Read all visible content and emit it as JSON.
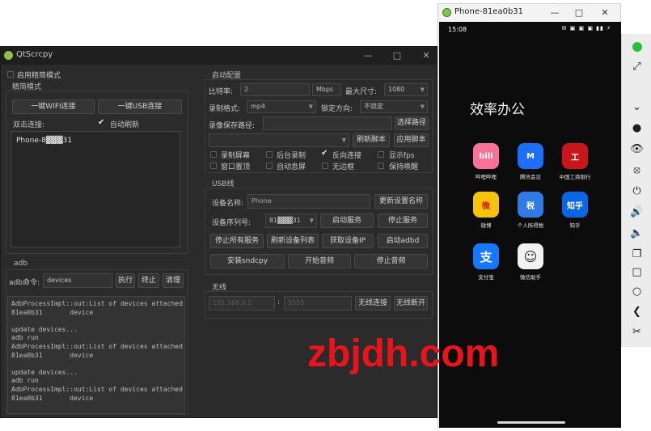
{
  "qt": {
    "title": "QtScrcpy",
    "simple_mode_check": "启用精简模式",
    "simple_mode_title": "精简模式",
    "wifi_btn": "一键WIFI连接",
    "usb_btn": "一键USB连接",
    "double_click_label": "双击连接:",
    "auto_refresh": "自动刷新",
    "device_item": "Phone-8▓▓▓31",
    "adb_title": "adb",
    "adb_cmd_label": "adb命令:",
    "adb_cmd_value": "devices",
    "run_btn": "执行",
    "stop_btn": "终止",
    "clear_btn": "清理",
    "log_text": "AdbProcessImpl::out:List of devices attached\n81ea0b31       device\n\nupdate devices...\nadb run\nAdbProcessImpl::out:List of devices attached\n81ea0b31       device\n\nupdate devices...\nadb run\nAdbProcessImpl::out:List of devices attached\n81ea0b31       device",
    "start_config_title": "启动配置",
    "bitrate_label": "比特率:",
    "bitrate_value": "2",
    "bitrate_unit": "Mbps",
    "max_size_label": "最大尺寸:",
    "max_size_value": "1080",
    "record_format_label": "录制格式:",
    "record_format_value": "mp4",
    "lock_dir_label": "锁定方向:",
    "lock_dir_value": "不锁定",
    "record_path_label": "录像保存路径:",
    "select_path_btn": "选择路径",
    "refresh_script_btn": "刷新脚本",
    "apply_script_btn": "应用脚本",
    "opt_record_screen": "录制屏幕",
    "opt_bg_record": "后台录制",
    "opt_reverse_conn": "反向连接",
    "opt_show_fps": "显示fps",
    "opt_window_top": "窗口置顶",
    "opt_auto_off": "自动息屏",
    "opt_frameless": "无边框",
    "opt_keep_awake": "保持唤醒",
    "usb_title": "USB线",
    "device_name_label": "设备名称:",
    "device_name_value": "Phone",
    "update_name_btn": "更新设置名称",
    "serial_label": "设备序列号:",
    "serial_value": "81▓▓▓31",
    "start_service_btn": "启动服务",
    "stop_service_btn": "停止服务",
    "stop_all_btn": "停止所有服务",
    "refresh_list_btn": "刷新设备列表",
    "get_ip_btn": "获取设备IP",
    "start_adbd_btn": "启动adbd",
    "install_sndcpy_btn": "安装sndcpy",
    "start_audio_btn": "开始音频",
    "stop_audio_btn": "停止音频",
    "wireless_title": "无线",
    "ip_placeholder": "192.168.0.1",
    "port_placeholder": "5555",
    "wireless_connect_btn": "无线连接",
    "wireless_disconnect_btn": "无线断开"
  },
  "phone": {
    "title": "Phone-81ea0b31",
    "status_time": "15:08",
    "status_icons": "✉ ▣ ▣ ▣ ▮▮ ⚡",
    "folder_title": "效率办公",
    "apps": [
      {
        "name": "哔哩哔哩",
        "glyph": "bili",
        "color": "#fb7299"
      },
      {
        "name": "腾讯会议",
        "glyph": "M",
        "color": "#1e6ff5"
      },
      {
        "name": "中国工商银行",
        "glyph": "工",
        "color": "#c8161d"
      },
      {
        "name": "微博",
        "glyph": "微",
        "color": "#f5c20c"
      },
      {
        "name": "个人所得税",
        "glyph": "税",
        "color": "#2f7ae5"
      },
      {
        "name": "知乎",
        "glyph": "知乎",
        "color": "#0a66e4"
      },
      {
        "name": "支付宝",
        "glyph": "支",
        "color": "#1677ff"
      },
      {
        "name": "微信助手",
        "glyph": "☺",
        "color": "#f2f2f2"
      }
    ]
  },
  "watermark": "zbjdh.com"
}
